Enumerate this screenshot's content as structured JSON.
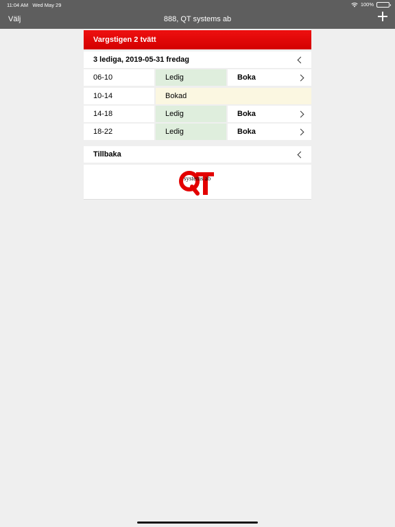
{
  "status": {
    "time": "11:04 AM",
    "date": "Wed May 29",
    "battery": "100%"
  },
  "nav": {
    "left_label": "Välj",
    "title": "888, QT systems ab"
  },
  "header": {
    "title": "Vargstigen 2 tvätt"
  },
  "date_row": {
    "label": "3 lediga, 2019-05-31  fredag"
  },
  "slots": [
    {
      "time": "06-10",
      "status": "Ledig",
      "action": "Boka"
    },
    {
      "time": "10-14",
      "status": "Bokad"
    },
    {
      "time": "14-18",
      "status": "Ledig",
      "action": "Boka"
    },
    {
      "time": "18-22",
      "status": "Ledig",
      "action": "Boka"
    }
  ],
  "back": {
    "label": "Tillbaka"
  },
  "logo": {
    "text": "systems ab",
    "letters": "QT",
    "color": "#e30000"
  },
  "colors": {
    "brand": "#e00000",
    "free": "#dfeedd",
    "booked": "#fbf7e1",
    "nav": "#5e5e5e"
  }
}
